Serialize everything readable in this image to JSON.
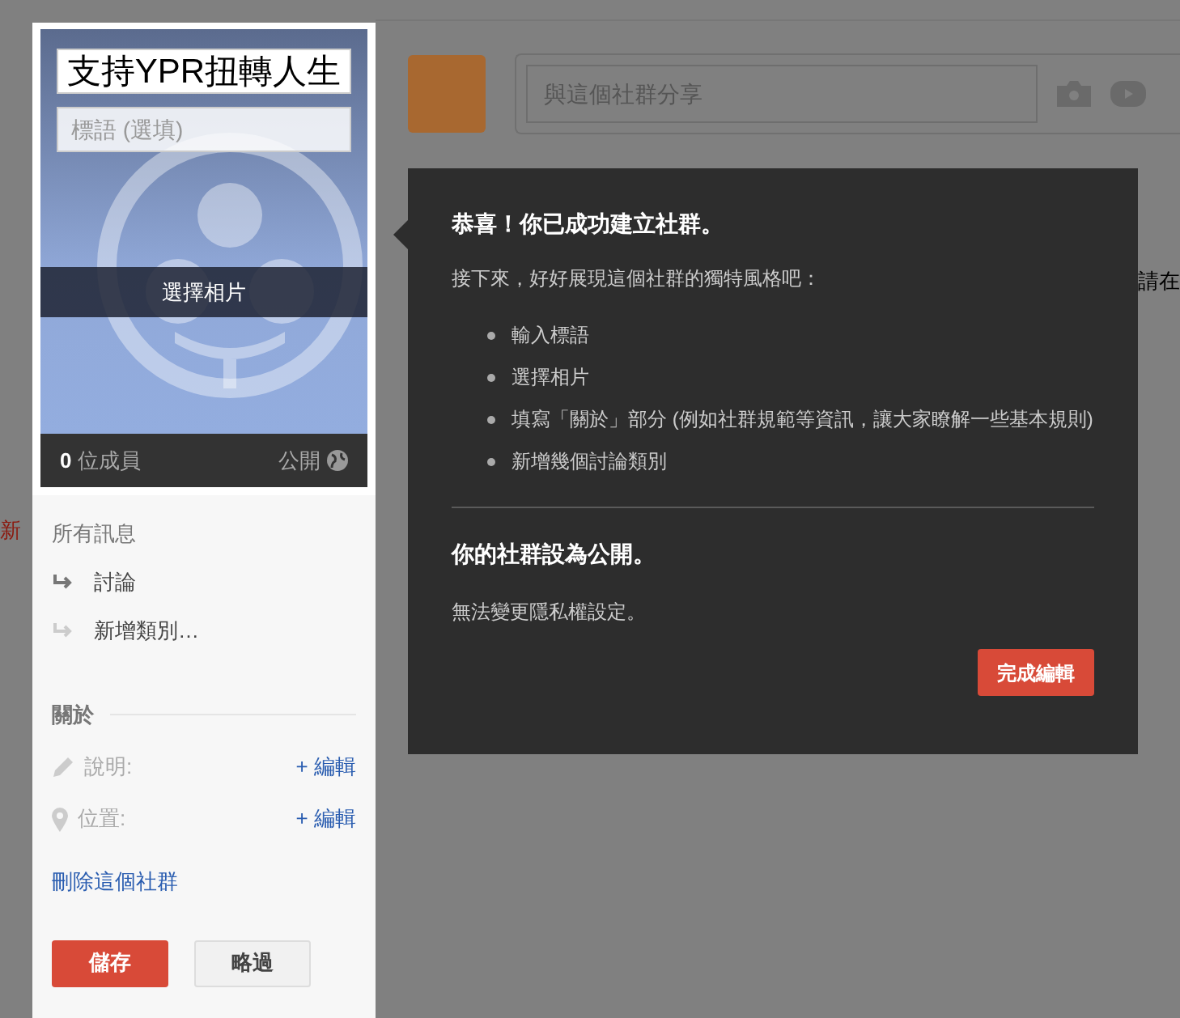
{
  "edge_fragments": {
    "left": "新",
    "right": "請在"
  },
  "card": {
    "title": "支持YPR扭轉人生",
    "tagline_placeholder": "標語 (選填)",
    "photo_button": "選擇相片",
    "member_count": "0",
    "member_label": "位成員",
    "visibility": "公開"
  },
  "nav": {
    "heading": "所有訊息",
    "items": [
      {
        "label": "討論",
        "kind": "category"
      },
      {
        "label": "新增類別…",
        "kind": "add"
      }
    ]
  },
  "about": {
    "heading": "關於",
    "rows": [
      {
        "label": "說明:",
        "kind": "description",
        "action": "+ 編輯"
      },
      {
        "label": "位置:",
        "kind": "location",
        "action": "+ 編輯"
      }
    ]
  },
  "delete_link": "刪除這個社群",
  "buttons": {
    "save": "儲存",
    "skip": "略過"
  },
  "share": {
    "placeholder": "與這個社群分享"
  },
  "popover": {
    "title": "恭喜！你已成功建立社群。",
    "intro": "接下來，好好展現這個社群的獨特風格吧：",
    "steps": [
      "輸入標語",
      "選擇相片",
      "填寫「關於」部分 (例如社群規範等資訊，讓大家瞭解一些基本規則)",
      "新增幾個討論類別"
    ],
    "subtitle": "你的社群設為公開。",
    "note": "無法變更隱私權設定。",
    "button": "完成編輯"
  }
}
